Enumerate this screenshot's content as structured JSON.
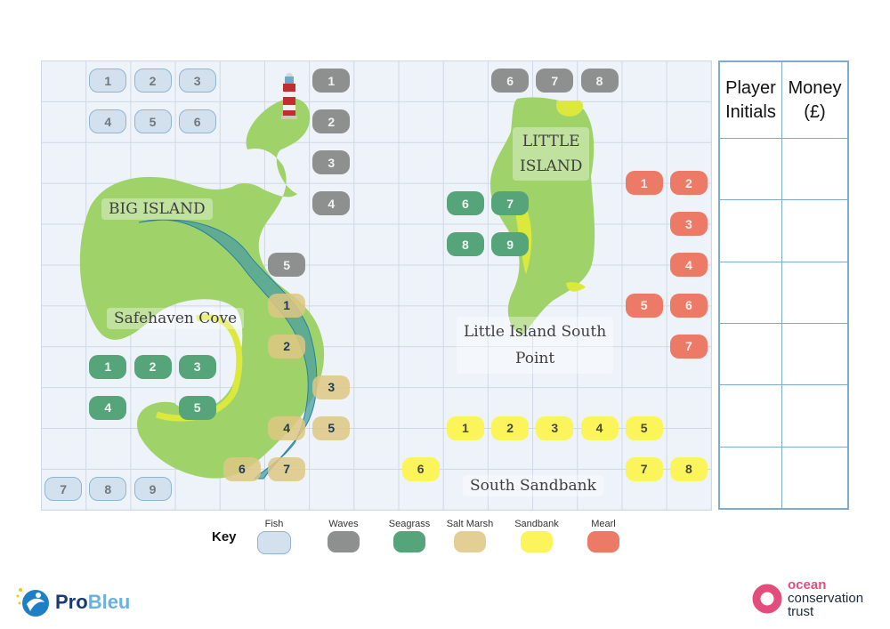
{
  "board": {
    "region_labels": {
      "big_island": "BIG ISLAND",
      "safehaven_cove": "Safehaven Cove",
      "little_island_line1": "LITTLE",
      "little_island_line2": "ISLAND",
      "little_island_south_line1": "Little Island South",
      "little_island_south_line2": "Point",
      "south_sandbank": "South Sandbank"
    },
    "tiles": [
      {
        "type": "fish",
        "label": "1",
        "col": 1,
        "row": 0
      },
      {
        "type": "fish",
        "label": "2",
        "col": 2,
        "row": 0
      },
      {
        "type": "fish",
        "label": "3",
        "col": 3,
        "row": 0
      },
      {
        "type": "fish",
        "label": "4",
        "col": 1,
        "row": 1
      },
      {
        "type": "fish",
        "label": "5",
        "col": 2,
        "row": 1
      },
      {
        "type": "fish",
        "label": "6",
        "col": 3,
        "row": 1
      },
      {
        "type": "fish",
        "label": "7",
        "col": 0,
        "row": 10
      },
      {
        "type": "fish",
        "label": "8",
        "col": 1,
        "row": 10
      },
      {
        "type": "fish",
        "label": "9",
        "col": 2,
        "row": 10
      },
      {
        "type": "waves",
        "label": "1",
        "col": 6,
        "row": 0
      },
      {
        "type": "waves",
        "label": "2",
        "col": 6,
        "row": 1
      },
      {
        "type": "waves",
        "label": "3",
        "col": 6,
        "row": 2
      },
      {
        "type": "waves",
        "label": "4",
        "col": 6,
        "row": 3
      },
      {
        "type": "waves",
        "label": "5",
        "col": 5,
        "row": 4.5
      },
      {
        "type": "waves",
        "label": "6",
        "col": 10,
        "row": 0
      },
      {
        "type": "waves",
        "label": "7",
        "col": 11,
        "row": 0
      },
      {
        "type": "waves",
        "label": "8",
        "col": 12,
        "row": 0
      },
      {
        "type": "seagrass",
        "label": "1",
        "col": 1,
        "row": 7
      },
      {
        "type": "seagrass",
        "label": "2",
        "col": 2,
        "row": 7
      },
      {
        "type": "seagrass",
        "label": "3",
        "col": 3,
        "row": 7
      },
      {
        "type": "seagrass",
        "label": "4",
        "col": 1,
        "row": 8
      },
      {
        "type": "seagrass",
        "label": "5",
        "col": 3,
        "row": 8
      },
      {
        "type": "seagrass",
        "label": "6",
        "col": 9,
        "row": 3
      },
      {
        "type": "seagrass",
        "label": "7",
        "col": 10,
        "row": 3
      },
      {
        "type": "seagrass",
        "label": "8",
        "col": 9,
        "row": 4
      },
      {
        "type": "seagrass",
        "label": "9",
        "col": 10,
        "row": 4
      },
      {
        "type": "saltmarsh",
        "label": "1",
        "col": 5,
        "row": 5.5
      },
      {
        "type": "saltmarsh",
        "label": "2",
        "col": 5,
        "row": 6.5
      },
      {
        "type": "saltmarsh",
        "label": "3",
        "col": 6,
        "row": 7.5
      },
      {
        "type": "saltmarsh",
        "label": "4",
        "col": 5,
        "row": 8.5
      },
      {
        "type": "saltmarsh",
        "label": "5",
        "col": 6,
        "row": 8.5
      },
      {
        "type": "saltmarsh",
        "label": "6",
        "col": 4,
        "row": 9.5
      },
      {
        "type": "saltmarsh",
        "label": "7",
        "col": 5,
        "row": 9.5
      },
      {
        "type": "sandbank",
        "label": "1",
        "col": 9,
        "row": 8.5
      },
      {
        "type": "sandbank",
        "label": "2",
        "col": 10,
        "row": 8.5
      },
      {
        "type": "sandbank",
        "label": "3",
        "col": 11,
        "row": 8.5
      },
      {
        "type": "sandbank",
        "label": "4",
        "col": 12,
        "row": 8.5
      },
      {
        "type": "sandbank",
        "label": "5",
        "col": 13,
        "row": 8.5
      },
      {
        "type": "sandbank",
        "label": "6",
        "col": 8,
        "row": 9.5
      },
      {
        "type": "sandbank",
        "label": "7",
        "col": 13,
        "row": 9.5
      },
      {
        "type": "sandbank",
        "label": "8",
        "col": 14,
        "row": 9.5
      },
      {
        "type": "mearl",
        "label": "1",
        "col": 13,
        "row": 2.5
      },
      {
        "type": "mearl",
        "label": "2",
        "col": 14,
        "row": 2.5
      },
      {
        "type": "mearl",
        "label": "3",
        "col": 14,
        "row": 3.5
      },
      {
        "type": "mearl",
        "label": "4",
        "col": 14,
        "row": 4.5
      },
      {
        "type": "mearl",
        "label": "5",
        "col": 13,
        "row": 5.5
      },
      {
        "type": "mearl",
        "label": "6",
        "col": 14,
        "row": 5.5
      },
      {
        "type": "mearl",
        "label": "7",
        "col": 14,
        "row": 6.5
      }
    ]
  },
  "score_table": {
    "headers": [
      "Player Initials",
      "Money (£)"
    ],
    "header_lines": [
      [
        "Player",
        "Initials"
      ],
      [
        "Money",
        "(£)"
      ]
    ],
    "rows": [
      [
        "",
        ""
      ],
      [
        "",
        ""
      ],
      [
        "",
        ""
      ],
      [
        "",
        ""
      ],
      [
        "",
        ""
      ],
      [
        "",
        ""
      ]
    ]
  },
  "key": {
    "title": "Key",
    "items": [
      {
        "label": "Fish",
        "type": "fish"
      },
      {
        "label": "Waves",
        "type": "waves"
      },
      {
        "label": "Seagrass",
        "type": "seagrass"
      },
      {
        "label": "Salt Marsh",
        "type": "saltmarsh"
      },
      {
        "label": "Sandbank",
        "type": "sandbank"
      },
      {
        "label": "Mearl",
        "type": "mearl"
      }
    ]
  },
  "colors": {
    "fish": "#d3e0ed",
    "waves": "#8e9090",
    "seagrass": "#55a47a",
    "saltmarsh": "#dec782",
    "sandbank": "#fbf45a",
    "mearl": "#ec7a66",
    "land": "#9fd36a",
    "river": "#4a9fa2",
    "grid": "#cfd8e4"
  },
  "logos": {
    "probleu_pro": "Pro",
    "probleu_bleu": "Bleu",
    "oct_line1": "ocean",
    "oct_line2": "conservation",
    "oct_line3": "trust"
  }
}
